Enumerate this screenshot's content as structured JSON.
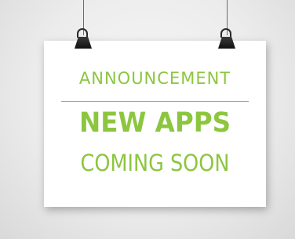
{
  "poster": {
    "announcement": "ANNOUNCEMENT",
    "headline": "NEW APPS",
    "subline": "COMING SOON"
  },
  "colors": {
    "accent": "#8cc63f",
    "paper": "#ffffff",
    "wall": "#ececec",
    "clip": "#1a1a1a"
  }
}
